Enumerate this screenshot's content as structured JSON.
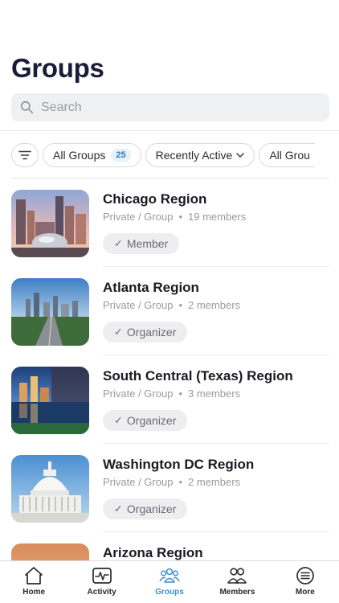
{
  "page": {
    "title": "Groups"
  },
  "search": {
    "placeholder": "Search",
    "value": ""
  },
  "filters": {
    "all_groups": {
      "label": "All Groups",
      "count": "25"
    },
    "sort": {
      "label": "Recently Active"
    },
    "partial": {
      "label": "All Grou"
    }
  },
  "groups": [
    {
      "name": "Chicago Region",
      "type": "Private / Group",
      "members": "19 members",
      "role": "Member"
    },
    {
      "name": "Atlanta Region",
      "type": "Private / Group",
      "members": "2 members",
      "role": "Organizer"
    },
    {
      "name": "South Central (Texas) Region",
      "type": "Private / Group",
      "members": "3 members",
      "role": "Organizer"
    },
    {
      "name": "Washington DC Region",
      "type": "Private / Group",
      "members": "2 members",
      "role": "Organizer"
    },
    {
      "name": "Arizona Region",
      "type": "",
      "members": "",
      "role": ""
    }
  ],
  "tabs": [
    {
      "label": "Home",
      "icon": "home-icon"
    },
    {
      "label": "Activity",
      "icon": "activity-icon"
    },
    {
      "label": "Groups",
      "icon": "groups-icon",
      "active": true
    },
    {
      "label": "Members",
      "icon": "members-icon"
    },
    {
      "label": "More",
      "icon": "more-icon"
    }
  ],
  "colors": {
    "accent": "#3f8fd0",
    "title": "#1c1b3a",
    "count_badge_bg": "#e4f1fb"
  }
}
